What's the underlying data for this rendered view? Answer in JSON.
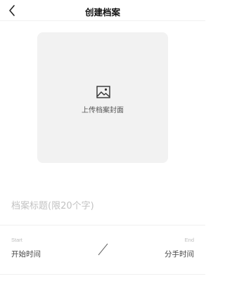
{
  "header": {
    "title": "创建档案",
    "back_icon": "chevron-left-icon"
  },
  "cover": {
    "icon": "image-icon",
    "label": "上传档案封面"
  },
  "title_field": {
    "placeholder": "档案标题(限20个字)",
    "value": ""
  },
  "time_range": {
    "start_label": "Start",
    "start_value": "开始时间",
    "end_label": "End",
    "end_value": "分手时间",
    "separator_icon": "slash-icon"
  }
}
